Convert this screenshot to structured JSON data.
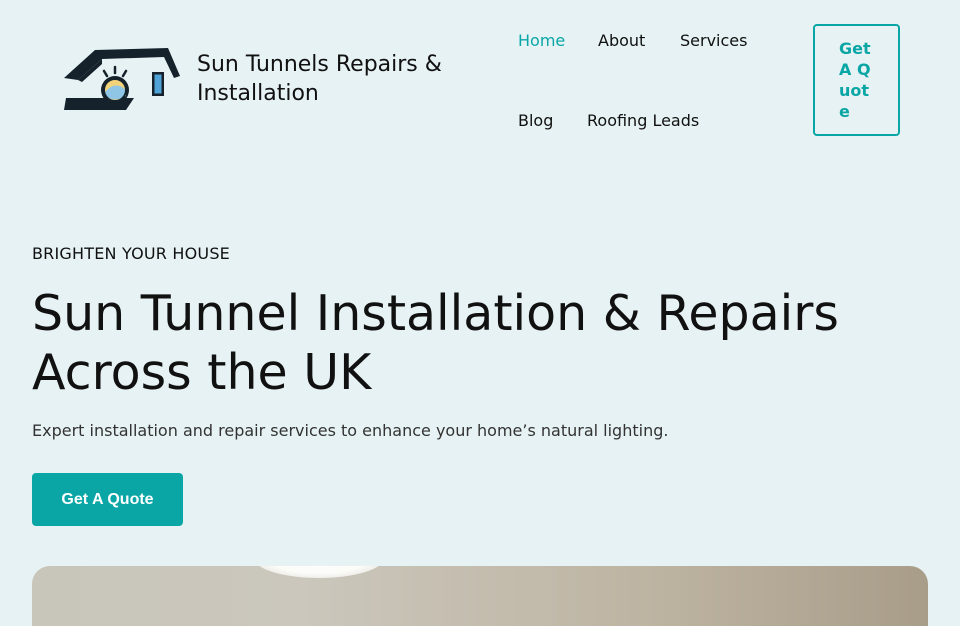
{
  "header": {
    "brand": "Sun Tunnels Repairs & Installation",
    "nav": [
      {
        "label": "Home",
        "active": true
      },
      {
        "label": "About",
        "active": false
      },
      {
        "label": "Services",
        "active": false
      },
      {
        "label": "Blog",
        "active": false
      },
      {
        "label": "Roofing Leads",
        "active": false
      }
    ],
    "cta_label": "Get A Quote"
  },
  "hero": {
    "eyebrow": "BRIGHTEN YOUR HOUSE",
    "title": "Sun Tunnel Installation & Repairs Across the UK",
    "subtitle": "Expert installation and repair services to enhance your home’s natural lighting.",
    "button_label": "Get A Quote"
  },
  "colors": {
    "accent": "#0aa6a6",
    "background": "#e6f2f4",
    "text": "#111111"
  },
  "icons": {
    "logo": "house-sun-tunnel-logo-icon"
  }
}
